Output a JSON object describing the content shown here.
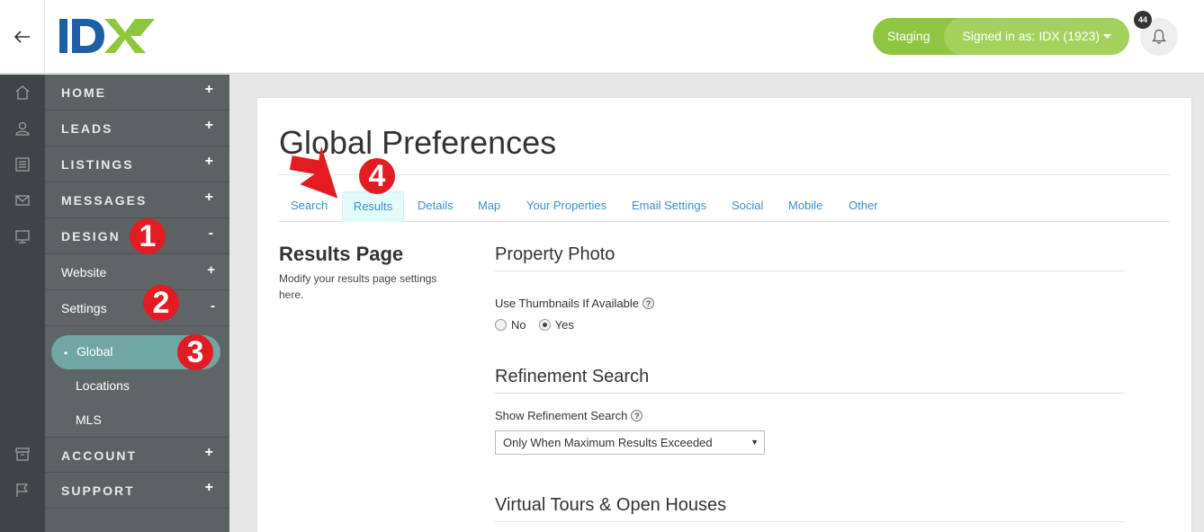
{
  "header": {
    "environment": "Staging",
    "signed_in": "Signed in as: IDX (1923)",
    "notification_count": "44"
  },
  "sidebar": {
    "items": [
      {
        "label": "HOME",
        "sign": "+"
      },
      {
        "label": "LEADS",
        "sign": "+"
      },
      {
        "label": "LISTINGS",
        "sign": "+"
      },
      {
        "label": "MESSAGES",
        "sign": "+"
      },
      {
        "label": "DESIGN",
        "sign": "-"
      },
      {
        "label": "ACCOUNT",
        "sign": "+"
      },
      {
        "label": "SUPPORT",
        "sign": "+"
      }
    ],
    "design_sub": [
      {
        "label": "Website",
        "sign": "+"
      },
      {
        "label": "Settings",
        "sign": "-"
      }
    ],
    "settings_sub": [
      "Global",
      "Locations",
      "MLS"
    ]
  },
  "markers": [
    "1",
    "2",
    "3",
    "4"
  ],
  "page": {
    "title": "Global Preferences",
    "tabs": [
      "Search",
      "Results",
      "Details",
      "Map",
      "Your Properties",
      "Email Settings",
      "Social",
      "Mobile",
      "Other"
    ],
    "active_tab": "Results",
    "section_title": "Results Page",
    "section_desc": "Modify your results page settings here."
  },
  "groups": {
    "photo": {
      "heading": "Property Photo",
      "field_label": "Use Thumbnails If Available",
      "options": [
        "No",
        "Yes"
      ],
      "selected": "Yes"
    },
    "refinement": {
      "heading": "Refinement Search",
      "field_label": "Show Refinement Search",
      "selected": "Only When Maximum Results Exceeded"
    },
    "tours": {
      "heading": "Virtual Tours & Open Houses"
    }
  },
  "colors": {
    "brand_green": "#8dc63f",
    "brand_blue": "#1f5fa8",
    "marker_red": "#e31b23",
    "active_pill": "#70a6a4",
    "link_blue": "#3d8fc7"
  }
}
